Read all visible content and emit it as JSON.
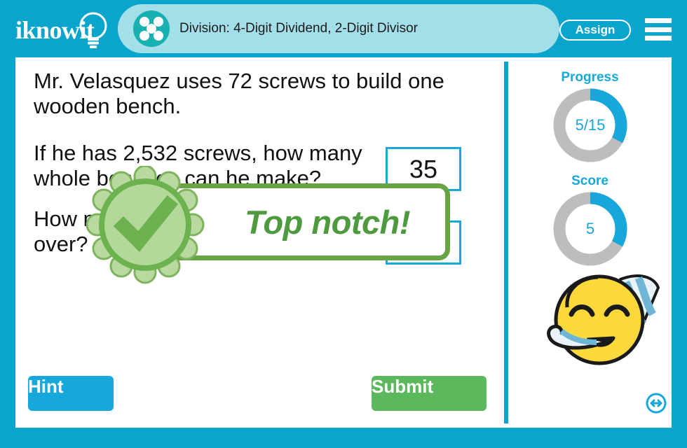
{
  "header": {
    "logo_text": "iknowit",
    "logo_icon": "lightbulb-icon",
    "subject_icon": "dice-five-dots-icon",
    "title": "Division: 4-Digit Dividend, 2-Digit Divisor",
    "assign_label": "Assign",
    "menu_icon": "hamburger-menu-icon",
    "brand_color": "#0aa5cd",
    "pill_color": "#a3dfe9"
  },
  "question": {
    "intro": "Mr. Velasquez uses 72 screws to build one wooden bench.",
    "body": "If he has 2,532 screws, how many whole benches can he make?",
    "tail": "How many screws will be left over?"
  },
  "answers": [
    {
      "name": "benches-answer",
      "value": "35"
    },
    {
      "name": "remainder-answer",
      "value": ""
    }
  ],
  "feedback": {
    "text": "Top notch!",
    "badge_icon": "rosette-checkmark-icon",
    "accent_color": "#68a345",
    "text_color": "#4d9a3f"
  },
  "sidebar": {
    "progress": {
      "label": "Progress",
      "value": "5/15",
      "current": 5,
      "total": 15,
      "percent": 33
    },
    "score": {
      "label": "Score",
      "value": "5",
      "current": 5,
      "total": 15,
      "percent": 33
    },
    "emoji_icon": "partying-face-emoji",
    "ring_active_color": "#17a8db",
    "ring_track_color": "#bdbdbd"
  },
  "footer": {
    "hint_label": "Hint",
    "submit_label": "Submit",
    "resize_icon": "resize-horizontal-circle-icon"
  }
}
